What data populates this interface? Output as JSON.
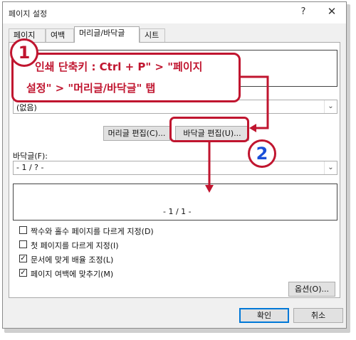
{
  "window": {
    "title": "페이지 설정",
    "help_glyph": "?",
    "close_glyph": "✕"
  },
  "tabs": [
    {
      "label": "페이지"
    },
    {
      "label": "여백"
    },
    {
      "label": "머리글/바닥글"
    },
    {
      "label": "시트"
    }
  ],
  "header": {
    "combo_value": "(없음)",
    "edit_header_button": "머리글 편집(C)...",
    "edit_footer_button": "바닥글 편집(U)..."
  },
  "footer": {
    "label": "바닥글(F):",
    "combo_value": "- 1 / ? -",
    "preview_text": "- 1 / 1 -"
  },
  "options": [
    {
      "label": "짝수와 홀수 페이지를 다르게 지정(D)",
      "checked": false
    },
    {
      "label": "첫 페이지를 다르게 지정(I)",
      "checked": false
    },
    {
      "label": "문서에 맞게 배율 조정(L)",
      "checked": true
    },
    {
      "label": "페이지 여백에 맞추기(M)",
      "checked": true
    }
  ],
  "buttons": {
    "options": "옵션(O)...",
    "ok": "확인",
    "cancel": "취소"
  },
  "annotation": {
    "step1": "1",
    "step2": "2",
    "line1": "인쇄 단축키 : Ctrl + P\" > \"페이지",
    "line2": "설정\" > \"머리글/바닥글\" 탭"
  },
  "colors": {
    "annotation_red": "#c0152f",
    "step2_blue": "#1a4fd8",
    "default_button_border": "#0078d7"
  }
}
